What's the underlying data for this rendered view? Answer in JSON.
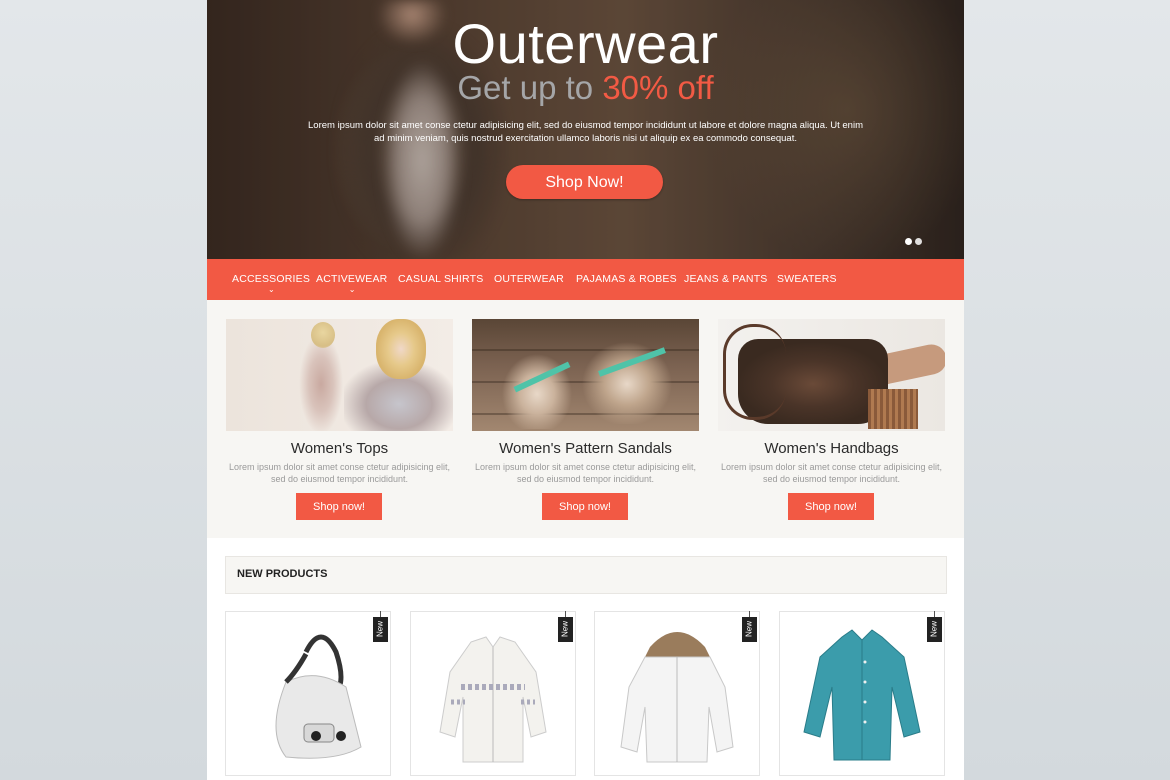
{
  "hero": {
    "title": "Outerwear",
    "subtitle_prefix": "Get up to",
    "subtitle_accent": "30% off",
    "description": "Lorem ipsum dolor sit amet conse ctetur adipisicing elit, sed do eiusmod tempor incididunt ut labore et dolore magna aliqua. Ut enim ad minim veniam, quis nostrud exercitation ullamco laboris nisi ut aliquip ex ea commodo consequat.",
    "button": "Shop Now!",
    "slide_count": 2
  },
  "nav": {
    "items": [
      {
        "label": "ACCESSORIES",
        "has_dropdown": true,
        "chevron": "⌄"
      },
      {
        "label": "ACTIVEWEAR",
        "has_dropdown": true,
        "chevron": "⌄"
      },
      {
        "label": "CASUAL SHIRTS",
        "has_dropdown": false
      },
      {
        "label": "OUTERWEAR",
        "has_dropdown": false
      },
      {
        "label": "PAJAMAS & ROBES",
        "has_dropdown": false
      },
      {
        "label": "JEANS & PANTS",
        "has_dropdown": false
      },
      {
        "label": "SWEATERS",
        "has_dropdown": false
      }
    ]
  },
  "categories": [
    {
      "title": "Women's Tops",
      "description": "Lorem ipsum dolor sit amet conse ctetur adipisicing elit, sed do eiusmod tempor incididunt.",
      "button": "Shop now!"
    },
    {
      "title": "Women's Pattern Sandals",
      "description": "Lorem ipsum dolor sit amet conse ctetur adipisicing elit, sed do eiusmod tempor incididunt.",
      "button": "Shop now!"
    },
    {
      "title": "Women's Handbags",
      "description": "Lorem ipsum dolor sit amet conse ctetur adipisicing elit, sed do eiusmod tempor incididunt.",
      "button": "Shop now!"
    }
  ],
  "new_products": {
    "title": "NEW PRODUCTS",
    "items": [
      {
        "image": "white-handbag",
        "tag": "New"
      },
      {
        "image": "white-sweater",
        "tag": "New"
      },
      {
        "image": "white-hooded-jacket",
        "tag": "New"
      },
      {
        "image": "teal-shirt",
        "tag": "New"
      }
    ]
  },
  "colors": {
    "accent": "#f25944",
    "nav_background": "#f25944",
    "section_background": "#f7f6f3",
    "page_background": "#dde2e5"
  }
}
